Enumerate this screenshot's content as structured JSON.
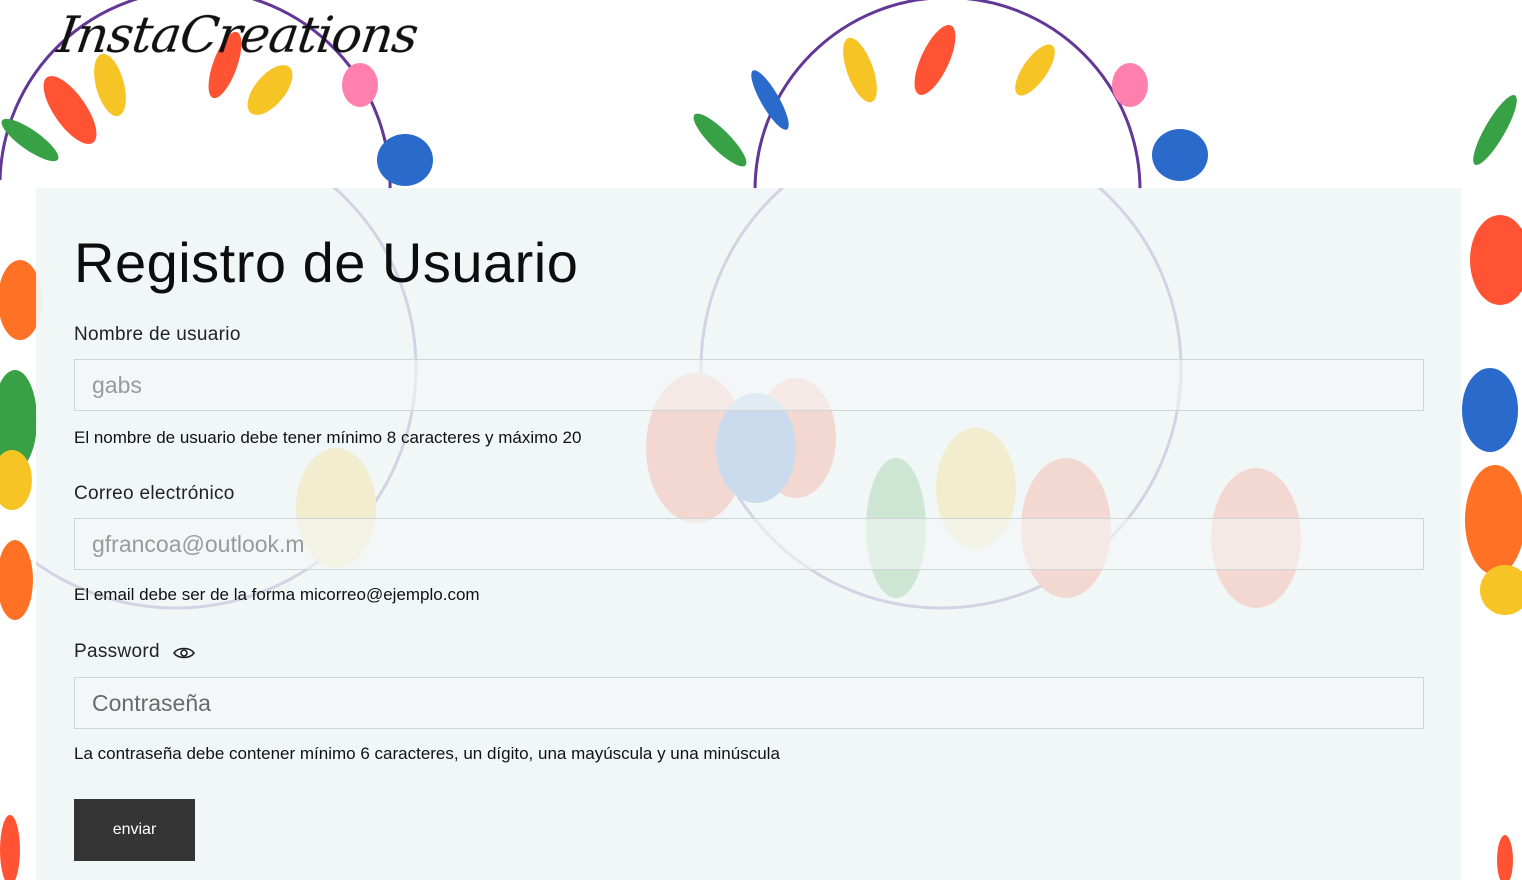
{
  "brand": {
    "logo_text": "InstaCreations"
  },
  "form": {
    "title": "Registro de Usuario",
    "username": {
      "label": "Nombre de usuario",
      "value": "gabs",
      "help": "El nombre de usuario debe tener mínimo 8 caracteres y máximo 20"
    },
    "email": {
      "label": "Correo electrónico",
      "value": "gfrancoa@outlook.m",
      "help": "El email debe ser de la forma micorreo@ejemplo.com"
    },
    "password": {
      "label": "Password",
      "placeholder": "Contraseña",
      "toggle_icon": "eye-icon",
      "help": "La contraseña debe contener mínimo 6 caracteres, un dígito, una mayúscula y una minúscula"
    },
    "submit_label": "enviar"
  },
  "colors": {
    "button_bg": "#343434",
    "panel_bg": "#f0f6f6",
    "text": "#111111"
  }
}
